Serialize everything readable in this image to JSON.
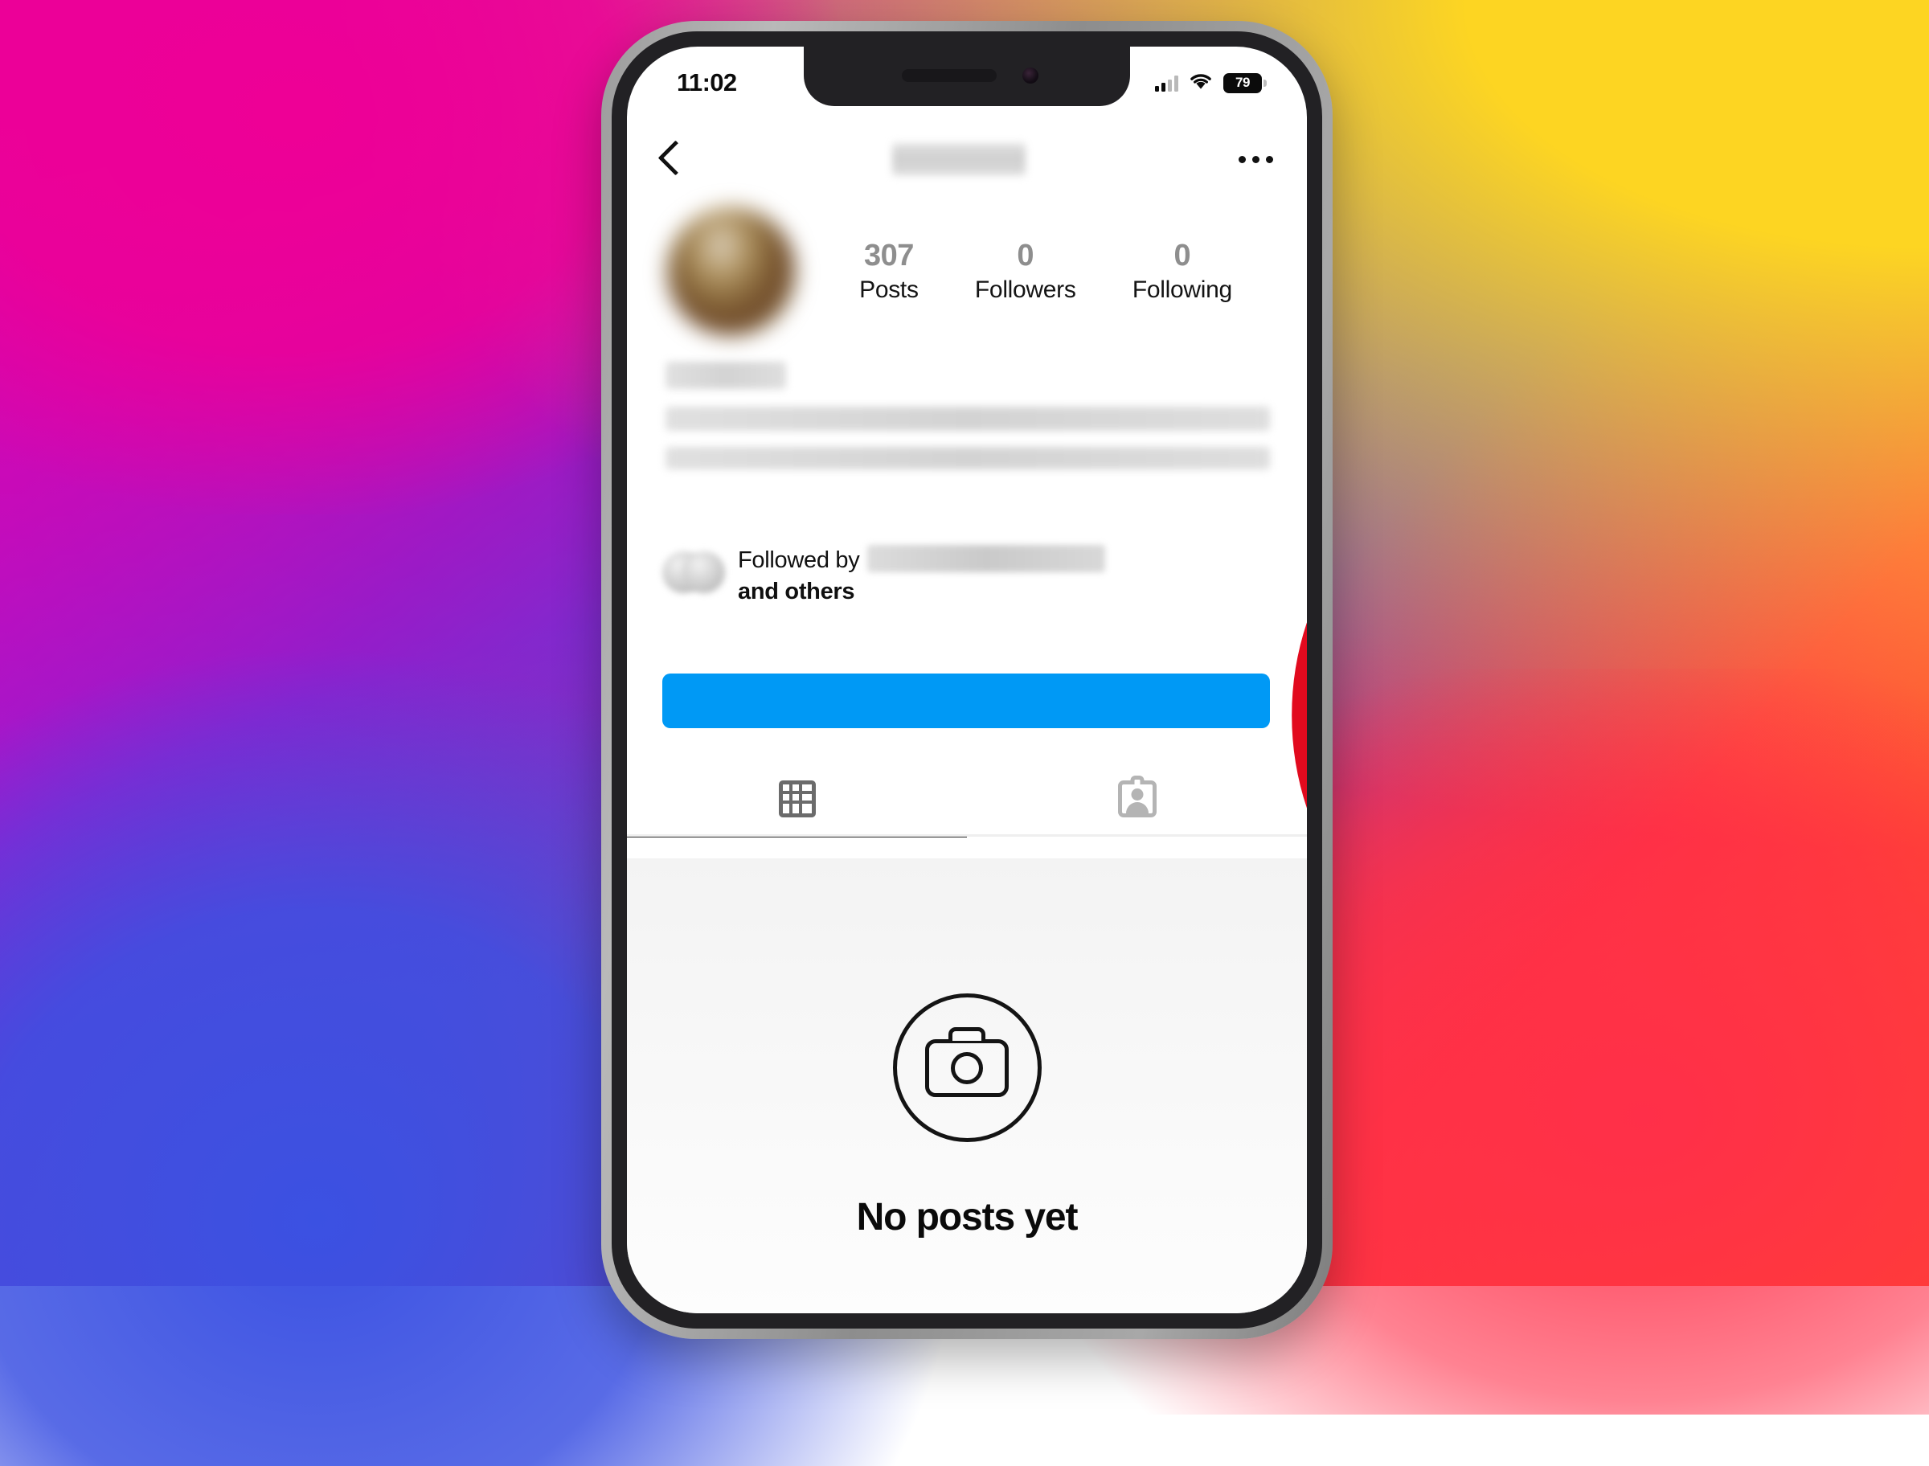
{
  "background": {
    "description": "instagram-gradient",
    "colors": {
      "magenta": "#E5009E",
      "purple": "#8A20D8",
      "blue": "#3B51E2",
      "pink": "#FF0F6E",
      "red": "#FF2F49",
      "orange": "#FF5C28",
      "yellow": "#FDD522"
    }
  },
  "device": {
    "model_style": "iphone-x-notch",
    "frame_color": "#9c9c9c",
    "bezel_color": "#222124"
  },
  "status_bar": {
    "time": "11:02",
    "cellular_icon": "cellular-signal-icon",
    "wifi_icon": "wifi-icon",
    "battery_level": "79",
    "battery_icon": "battery-icon"
  },
  "nav_bar": {
    "back_icon": "back-chevron-icon",
    "title": "",
    "title_state": "blurred",
    "more_icon": "more-options-icon"
  },
  "profile": {
    "avatar_state": "blurred",
    "stats": [
      {
        "value": "307",
        "label": "Posts"
      },
      {
        "value": "0",
        "label": "Followers"
      },
      {
        "value": "0",
        "label": "Following"
      }
    ],
    "name_state": "blurred",
    "bio_state": "blurred",
    "followed_by": {
      "prefix": "Fo",
      "text_visible": "Followed by",
      "mid": "by",
      "suffix_line": "and",
      "suffix_bold": "others",
      "full_line_1": "Followed by",
      "full_line_2": "and others",
      "username_state": "blurred"
    },
    "action_button": {
      "label": "",
      "color": "#0099F5",
      "state": "solid-blue"
    }
  },
  "tabs": [
    {
      "icon": "grid-posts-icon",
      "name": "posts",
      "active": true
    },
    {
      "icon": "tagged-photos-icon",
      "name": "tagged",
      "active": false
    }
  ],
  "empty_state": {
    "icon": "camera-outline-icon",
    "title": "No posts yet"
  },
  "overlay": {
    "icon": "prohibition-sign-icon",
    "meaning": "blocked",
    "color": "#E20A1E"
  }
}
